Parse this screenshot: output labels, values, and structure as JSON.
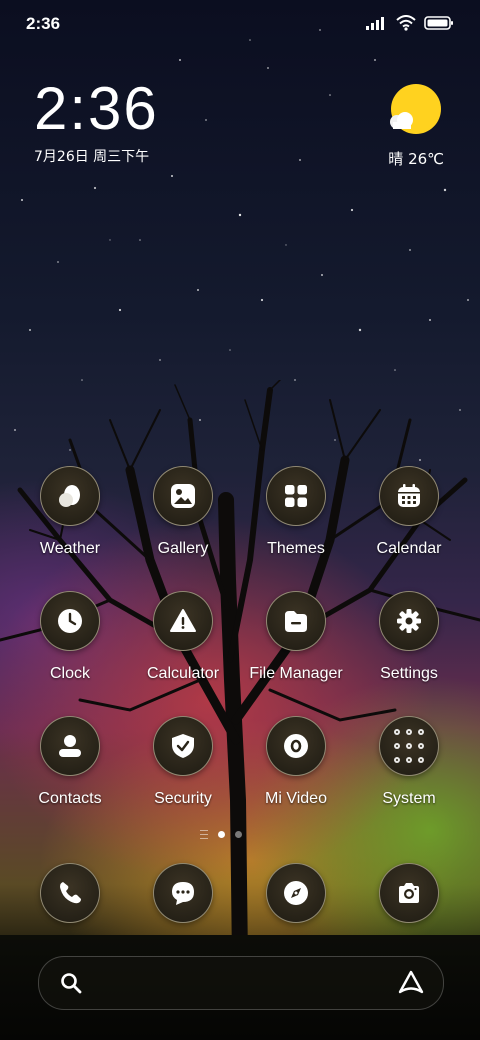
{
  "status_bar": {
    "time": "2:36",
    "icons": [
      "signal-icon",
      "wifi-icon",
      "battery-icon"
    ]
  },
  "clock_widget": {
    "time": "2:36",
    "date": "7月26日 周三下午"
  },
  "weather_widget": {
    "icon": "sun-cloud-icon",
    "text": "晴 26℃",
    "sun_color": "#ffd21f"
  },
  "apps": [
    {
      "label": "Weather",
      "icon": "weather-icon"
    },
    {
      "label": "Gallery",
      "icon": "gallery-icon"
    },
    {
      "label": "Themes",
      "icon": "themes-icon"
    },
    {
      "label": "Calendar",
      "icon": "calendar-icon"
    },
    {
      "label": "Clock",
      "icon": "clock-icon"
    },
    {
      "label": "Calculator",
      "icon": "calculator-icon"
    },
    {
      "label": "File Manager",
      "icon": "file-manager-icon"
    },
    {
      "label": "Settings",
      "icon": "settings-icon"
    },
    {
      "label": "Contacts",
      "icon": "contacts-icon"
    },
    {
      "label": "Security",
      "icon": "security-icon"
    },
    {
      "label": "Mi Video",
      "icon": "mi-video-icon"
    },
    {
      "label": "System",
      "icon": "system-folder-icon"
    }
  ],
  "page_indicator": {
    "pages": 2,
    "active": 1
  },
  "dock": [
    {
      "icon": "phone-icon"
    },
    {
      "icon": "messages-icon"
    },
    {
      "icon": "browser-icon"
    },
    {
      "icon": "camera-icon"
    }
  ],
  "search_bar": {
    "left_icon": "search-icon",
    "right_icon": "assistant-icon"
  }
}
